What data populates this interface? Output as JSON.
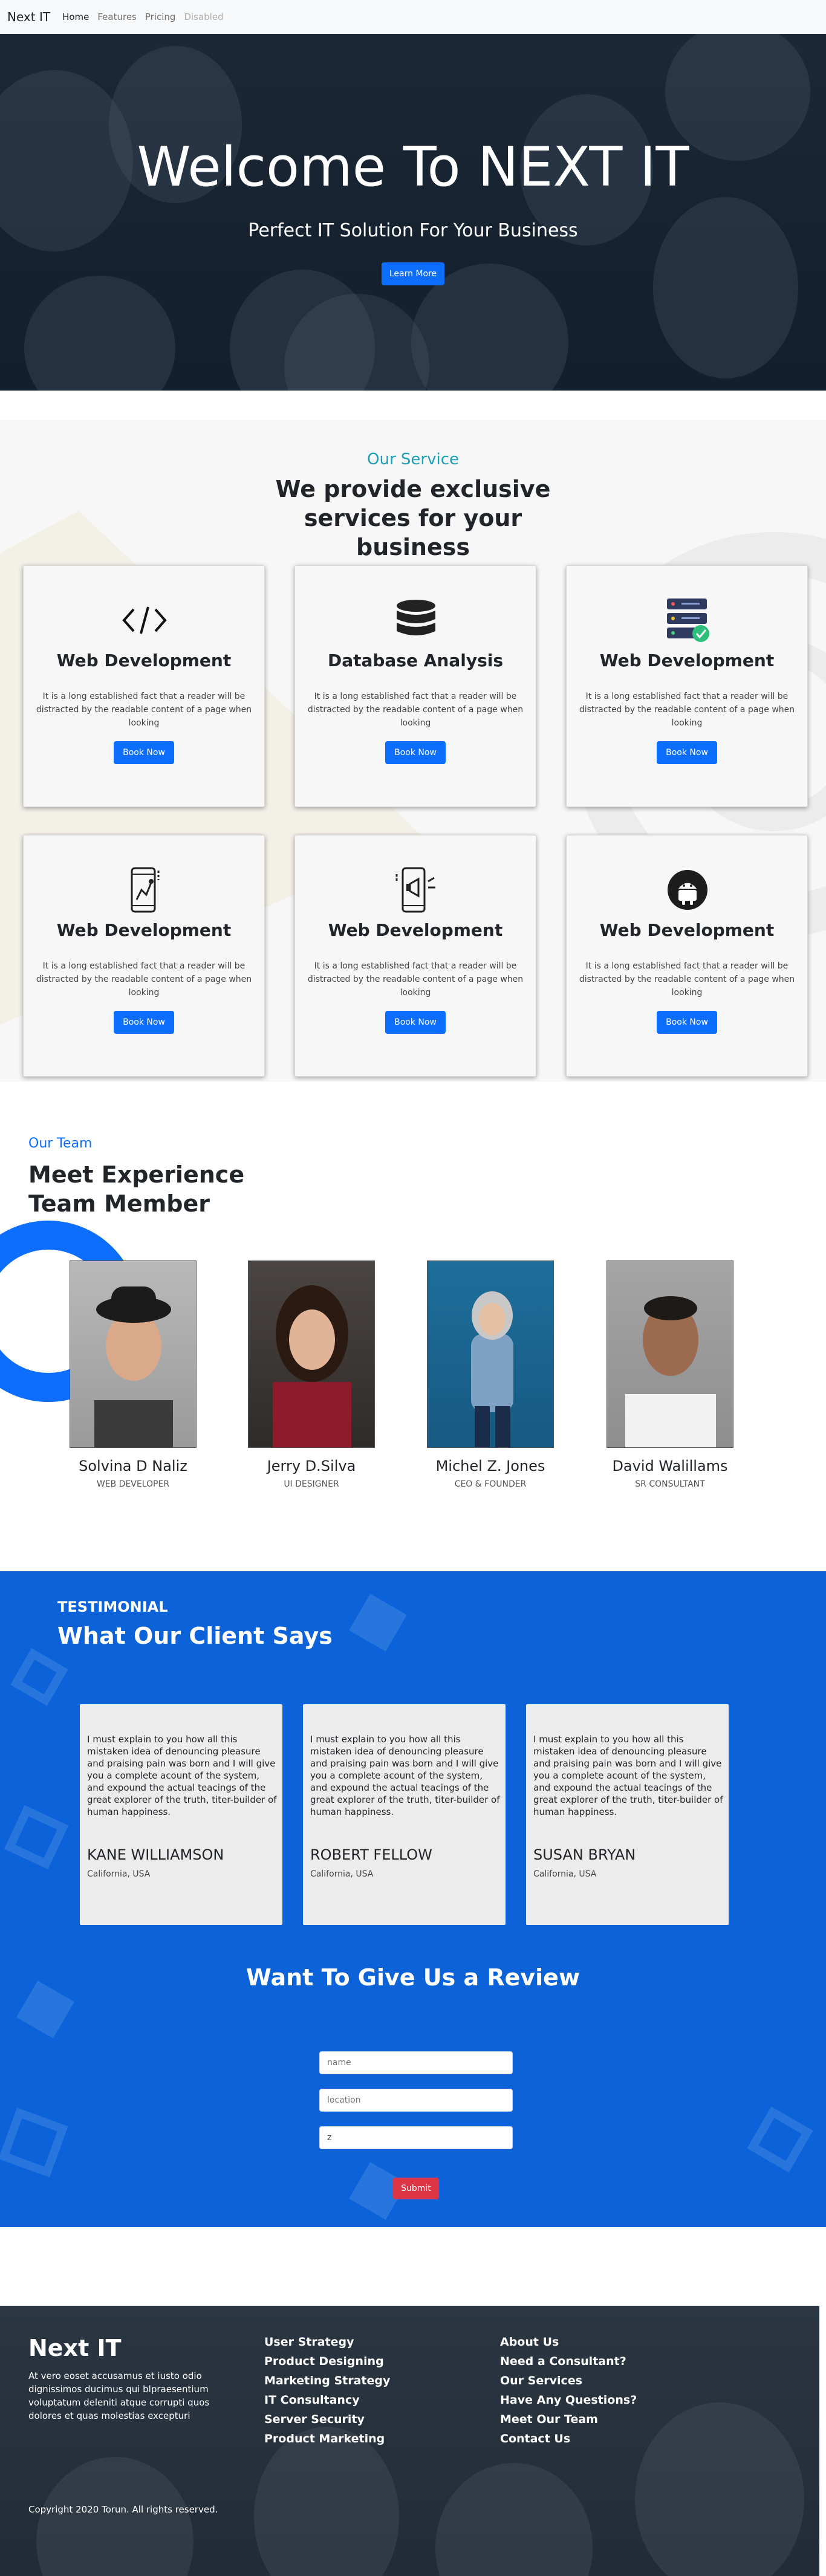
{
  "navbar": {
    "brand": "Next IT",
    "links": [
      {
        "label": "Home",
        "state": "active"
      },
      {
        "label": "Features",
        "state": "normal"
      },
      {
        "label": "Pricing",
        "state": "normal"
      },
      {
        "label": "Disabled",
        "state": "disabled"
      }
    ]
  },
  "hero": {
    "title": "Welcome To NEXT IT",
    "subtitle": "Perfect IT Solution For Your Business",
    "button": "Learn More"
  },
  "services": {
    "eyebrow": "Our Service",
    "heading": "We provide exclusive services for your business",
    "cards": [
      {
        "icon": "code-icon",
        "title": "Web Development",
        "text": "It is a long established fact that a reader will be distracted by the readable content of a page when looking",
        "button": "Book Now"
      },
      {
        "icon": "database-icon",
        "title": "Database Analysis",
        "text": "It is a long established fact that a reader will be distracted by the readable content of a page when looking",
        "button": "Book Now"
      },
      {
        "icon": "server-check-icon",
        "title": "Web Development",
        "text": "It is a long established fact that a reader will be distracted by the readable content of a page when looking",
        "button": "Book Now"
      },
      {
        "icon": "mobile-map-icon",
        "title": "Web Development",
        "text": "It is a long established fact that a reader will be distracted by the readable content of a page when looking",
        "button": "Book Now"
      },
      {
        "icon": "mobile-megaphone-icon",
        "title": "Web Development",
        "text": "It is a long established fact that a reader will be distracted by the readable content of a page when looking",
        "button": "Book Now"
      },
      {
        "icon": "android-icon",
        "title": "Web Development",
        "text": "It is a long established fact that a reader will be distracted by the readable content of a page when looking",
        "button": "Book Now"
      }
    ]
  },
  "team": {
    "eyebrow": "Our Team",
    "heading": "Meet Experience Team Member",
    "members": [
      {
        "name": "Solvina D Naliz",
        "role": "WEB DEVELOPER"
      },
      {
        "name": "Jerry D.Silva",
        "role": "UI DESIGNER"
      },
      {
        "name": "Michel Z. Jones",
        "role": "CEO & FOUNDER"
      },
      {
        "name": "David Walillams",
        "role": "SR CONSULTANT"
      }
    ]
  },
  "testimonial": {
    "eyebrow": "TESTIMONIAL",
    "heading": "What Our Client Says",
    "items": [
      {
        "text": "I must explain to you how all this mistaken idea of denouncing pleasure and praising pain was born and I will give you a complete acount of the system, and expound the actual teacings of the great explorer of the truth, titer-builder of human happiness.",
        "name": "KANE WILLIAMSON",
        "location": "California, USA"
      },
      {
        "text": "I must explain to you how all this mistaken idea of denouncing pleasure and praising pain was born and I will give you a complete acount of the system, and expound the actual teacings of the great explorer of the truth, titer-builder of human happiness.",
        "name": "ROBERT FELLOW",
        "location": "California, USA"
      },
      {
        "text": "I must explain to you how all this mistaken idea of denouncing pleasure and praising pain was born and I will give you a complete acount of the system, and expound the actual teacings of the great explorer of the truth, titer-builder of human happiness.",
        "name": "SUSAN BRYAN",
        "location": "California, USA"
      }
    ]
  },
  "review": {
    "heading": "Want To Give Us a Review",
    "name_placeholder": "name",
    "location_placeholder": "location",
    "comment_value": "z",
    "submit": "Submit"
  },
  "footer": {
    "brand": "Next IT",
    "description": "At vero eoset accusamus et iusto odio dignissimos ducimus qui blpraesentium voluptatum deleniti atque corrupti quos dolores et quas molestias excepturi",
    "col1": [
      "User Strategy",
      "Product Designing",
      "Marketing Strategy",
      "IT Consultancy",
      "Server Security",
      "Product Marketing"
    ],
    "col2": [
      "About Us",
      "Need a Consultant?",
      "Our Services",
      "Have Any Questions?",
      "Meet Our Team",
      "Contact Us"
    ],
    "copyright": "Copyright 2020 Torun. All rights reserved."
  },
  "colors": {
    "primary": "#0d6efd",
    "testimonial_bg": "#0b62d9",
    "service_eyebrow": "#1aa0b5",
    "submit": "#dc3545",
    "hero_bg": "#152230",
    "footer_bg": "#2b3642"
  }
}
